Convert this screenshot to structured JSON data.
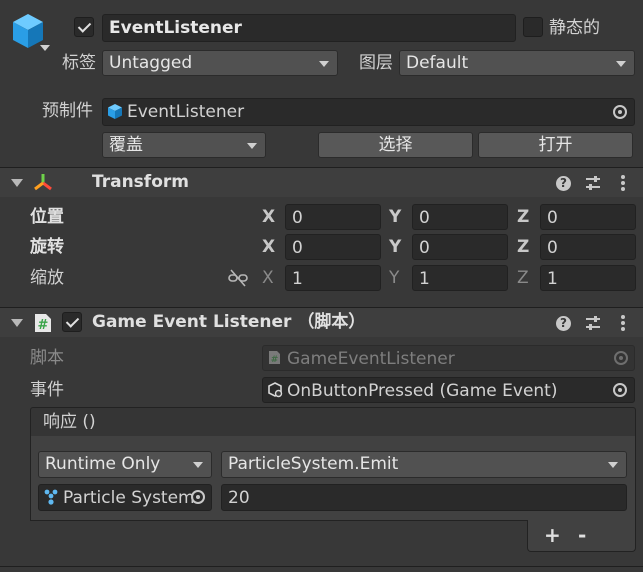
{
  "object": {
    "name": "EventListener",
    "active": true,
    "static_label": "静态的",
    "static_checked": false,
    "tag_label": "标签",
    "tag_value": "Untagged",
    "layer_label": "图层",
    "layer_value": "Default",
    "prefab_label": "预制件",
    "prefab_value": "EventListener",
    "overrides_label": "覆盖",
    "select_label": "选择",
    "open_label": "打开"
  },
  "transform": {
    "title": "Transform",
    "position_label": "位置",
    "rotation_label": "旋转",
    "scale_label": "缩放",
    "axis_x": "X",
    "axis_y": "Y",
    "axis_z": "Z",
    "position": {
      "x": "0",
      "y": "0",
      "z": "0"
    },
    "rotation": {
      "x": "0",
      "y": "0",
      "z": "0"
    },
    "scale": {
      "x": "1",
      "y": "1",
      "z": "1"
    }
  },
  "component": {
    "title": "Game Event Listener （脚本）",
    "enabled": true,
    "script_label": "脚本",
    "script_value": "GameEventListener",
    "event_label": "事件",
    "event_value": "OnButtonPressed (Game Event)",
    "response_header": "响应 ()",
    "runtime_value": "Runtime Only",
    "function_value": "ParticleSystem.Emit",
    "target_value": "Particle System",
    "argument_value": "20",
    "add_label": "+",
    "remove_label": "-"
  },
  "icons": {
    "object": "cube-icon",
    "prefab": "prefab-cube-icon",
    "transform": "transform-axes-icon",
    "script": "hash-script-icon",
    "event": "scriptable-object-icon",
    "particle": "particle-system-icon",
    "help": "help-icon",
    "presets": "presets-sliders-icon",
    "more": "kebab-menu-icon",
    "link": "link-broken-icon"
  },
  "colors": {
    "background": "#383838",
    "field": "#2a2a2a",
    "accent_blue": "#3aa0e0"
  }
}
